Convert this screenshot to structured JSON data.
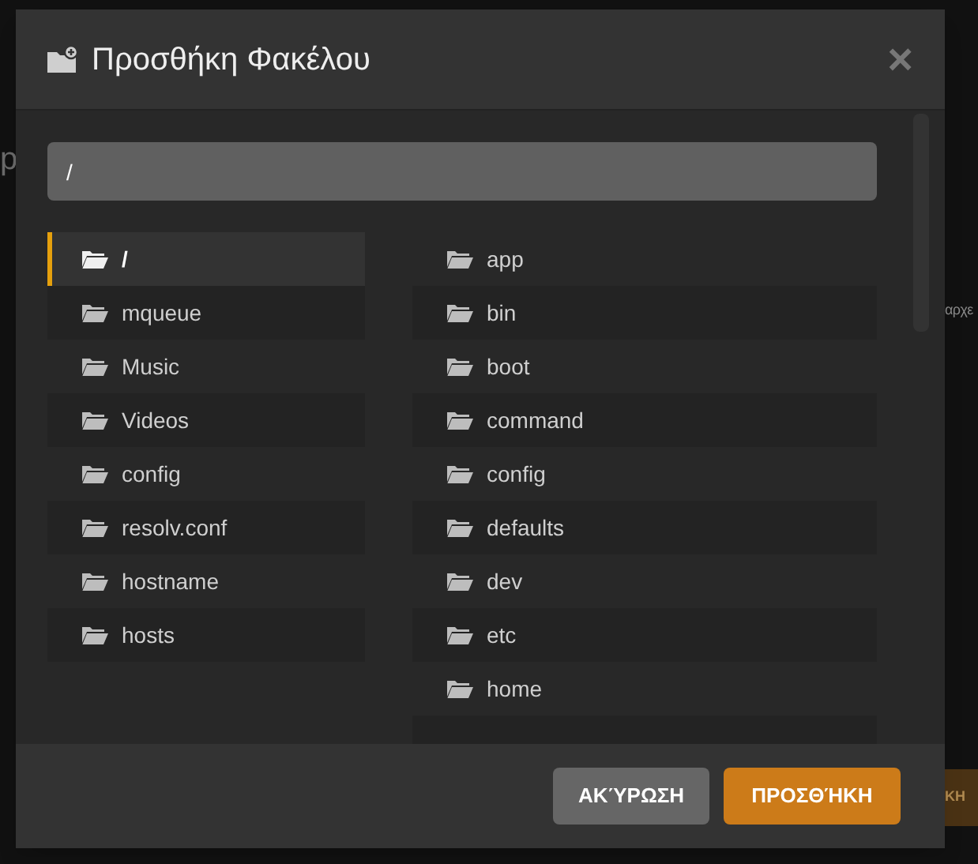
{
  "background": {
    "fragments": [
      "p",
      "αρχε",
      "ΚΗ"
    ]
  },
  "dialog": {
    "title": "Προσθήκη Φακέλου",
    "close": "×",
    "path": {
      "value": "/"
    },
    "left_list": [
      {
        "name": "/",
        "selected": true
      },
      {
        "name": "mqueue",
        "selected": false
      },
      {
        "name": "Music",
        "selected": false
      },
      {
        "name": "Videos",
        "selected": false
      },
      {
        "name": "config",
        "selected": false
      },
      {
        "name": "resolv.conf",
        "selected": false
      },
      {
        "name": "hostname",
        "selected": false
      },
      {
        "name": "hosts",
        "selected": false
      }
    ],
    "right_list": [
      {
        "name": "app",
        "selected": false
      },
      {
        "name": "bin",
        "selected": false
      },
      {
        "name": "boot",
        "selected": false
      },
      {
        "name": "command",
        "selected": false
      },
      {
        "name": "config",
        "selected": false
      },
      {
        "name": "defaults",
        "selected": false
      },
      {
        "name": "dev",
        "selected": false
      },
      {
        "name": "etc",
        "selected": false
      },
      {
        "name": "home",
        "selected": false
      }
    ],
    "buttons": [
      {
        "label": "ΑΚΎΡΩΣΗ",
        "kind": "secondary"
      },
      {
        "label": "ΠΡΟΣΘΉΚΗ",
        "kind": "primary"
      }
    ]
  }
}
